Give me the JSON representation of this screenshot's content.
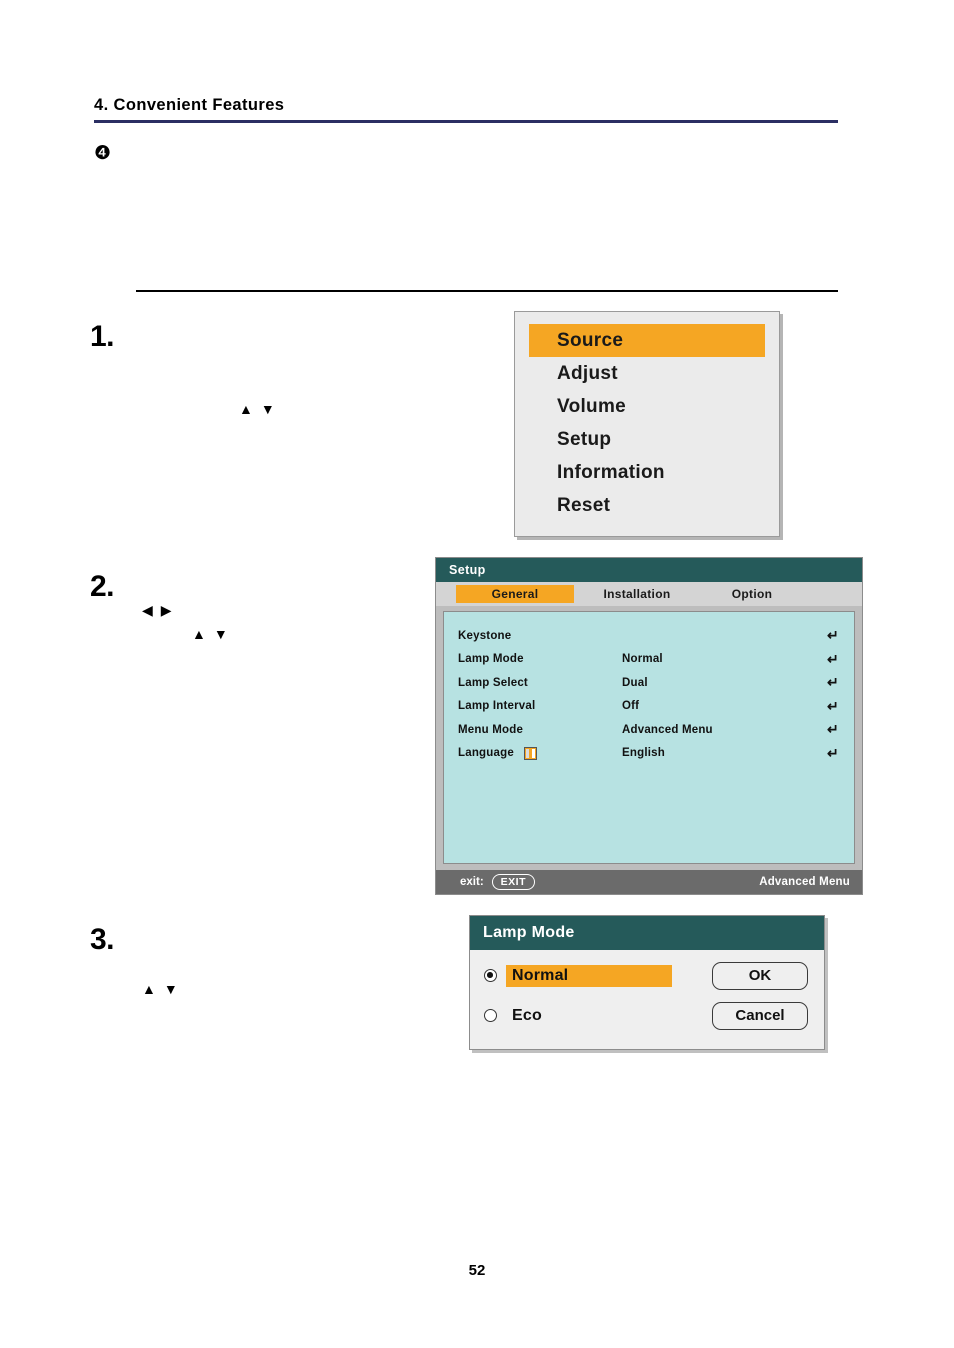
{
  "page": {
    "chapter_title": "4. Convenient Features",
    "section_bullet": "❹",
    "page_number": "52",
    "rule_color": "#2b2f63"
  },
  "steps": [
    {
      "number": "1.",
      "keys": [
        "▲",
        "▼"
      ]
    },
    {
      "number": "2.",
      "keys_lr": [
        "◀",
        "▶"
      ],
      "keys_ud": [
        "▲",
        "▼"
      ]
    },
    {
      "number": "3.",
      "keys": [
        "▲",
        "▼"
      ]
    }
  ],
  "osd_main_menu": {
    "name": "main-menu",
    "items": [
      {
        "label": "Source",
        "selected": true
      },
      {
        "label": "Adjust",
        "selected": false
      },
      {
        "label": "Volume",
        "selected": false
      },
      {
        "label": "Setup",
        "selected": false
      },
      {
        "label": "Information",
        "selected": false
      },
      {
        "label": "Reset",
        "selected": false
      }
    ],
    "highlight_color": "#f5a623",
    "background_color": "#ebebeb"
  },
  "osd_setup": {
    "title": "Setup",
    "title_bar_color": "#255a5a",
    "body_color": "#b7e2e2",
    "tabs": [
      {
        "label": "General",
        "selected": true
      },
      {
        "label": "Installation",
        "selected": false
      },
      {
        "label": "Option",
        "selected": false
      }
    ],
    "rows": [
      {
        "label": "Keystone",
        "value": "",
        "enter": "↵",
        "has_icon": false
      },
      {
        "label": "Lamp Mode",
        "value": "Normal",
        "enter": "↵",
        "has_icon": false
      },
      {
        "label": "Lamp Select",
        "value": "Dual",
        "enter": "↵",
        "has_icon": false
      },
      {
        "label": "Lamp Interval",
        "value": "Off",
        "enter": "↵",
        "has_icon": false
      },
      {
        "label": "Menu Mode",
        "value": "Advanced Menu",
        "enter": "↵",
        "has_icon": false
      },
      {
        "label": "Language",
        "value": "English",
        "enter": "↵",
        "has_icon": true
      }
    ],
    "footer": {
      "exit_label": "exit:",
      "exit_button": "EXIT",
      "mode_label": "Advanced Menu"
    }
  },
  "osd_lamp_mode": {
    "title": "Lamp Mode",
    "title_bar_color": "#255a5a",
    "options": [
      {
        "label": "Normal",
        "selected": true
      },
      {
        "label": "Eco",
        "selected": false
      }
    ],
    "buttons": [
      {
        "label": "OK"
      },
      {
        "label": "Cancel"
      }
    ]
  }
}
